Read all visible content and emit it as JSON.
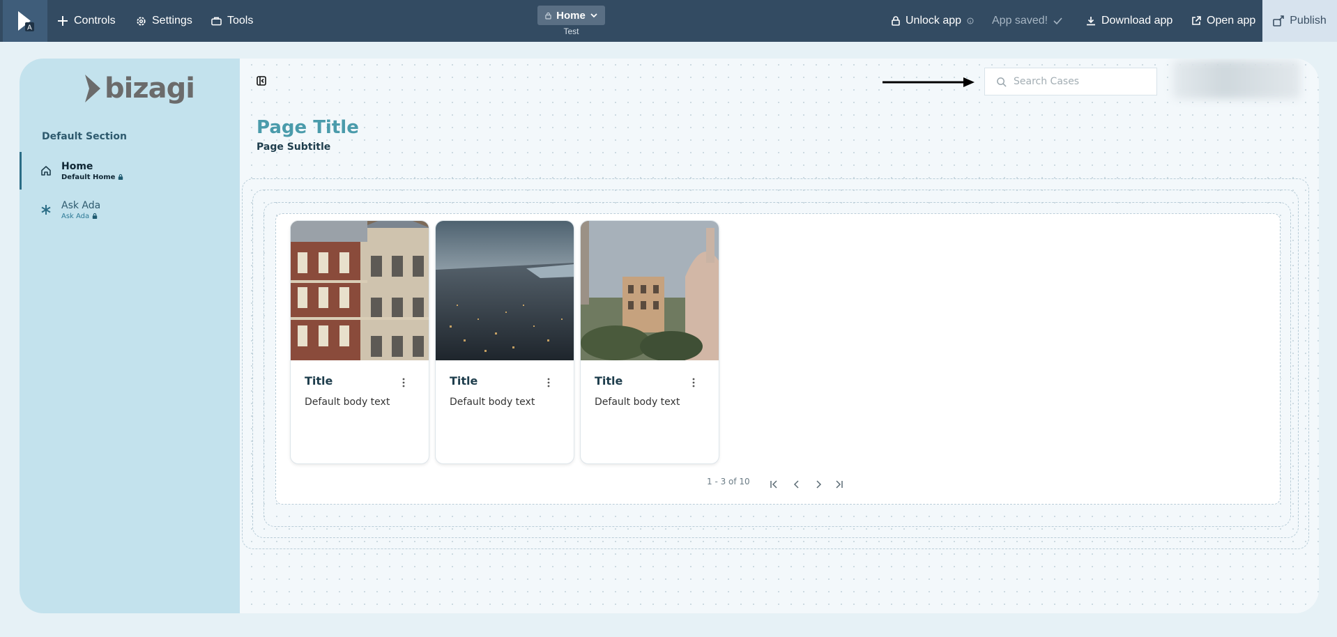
{
  "topbar": {
    "logo_letter": "A",
    "controls": "Controls",
    "settings": "Settings",
    "tools": "Tools",
    "page_selector": "Home",
    "page_selector_sub": "Test",
    "unlock": "Unlock app",
    "saved": "App saved!",
    "download": "Download app",
    "open": "Open app",
    "publish": "Publish"
  },
  "sidebar": {
    "brand": "bizagi",
    "section": "Default Section",
    "items": [
      {
        "label": "Home",
        "sub": "Default Home",
        "icon": "home-icon",
        "active": true
      },
      {
        "label": "Ask Ada",
        "sub": "Ask Ada",
        "icon": "asterisk-icon",
        "active": false
      }
    ]
  },
  "main": {
    "search_placeholder": "Search Cases",
    "page_title": "Page Title",
    "page_subtitle": "Page Subtitle",
    "cards": [
      {
        "title": "Title",
        "body": "Default body text",
        "image": "baroque-palace"
      },
      {
        "title": "Title",
        "body": "Default body text",
        "image": "city-aerial-dusk"
      },
      {
        "title": "Title",
        "body": "Default body text",
        "image": "rome-dome"
      }
    ],
    "pager": "1 - 3 of 10"
  },
  "colors": {
    "topbar": "#334b62",
    "sidebar": "#c3e2ed",
    "accent_title": "#4a9bab",
    "publish_bg": "#d7e3ee"
  }
}
